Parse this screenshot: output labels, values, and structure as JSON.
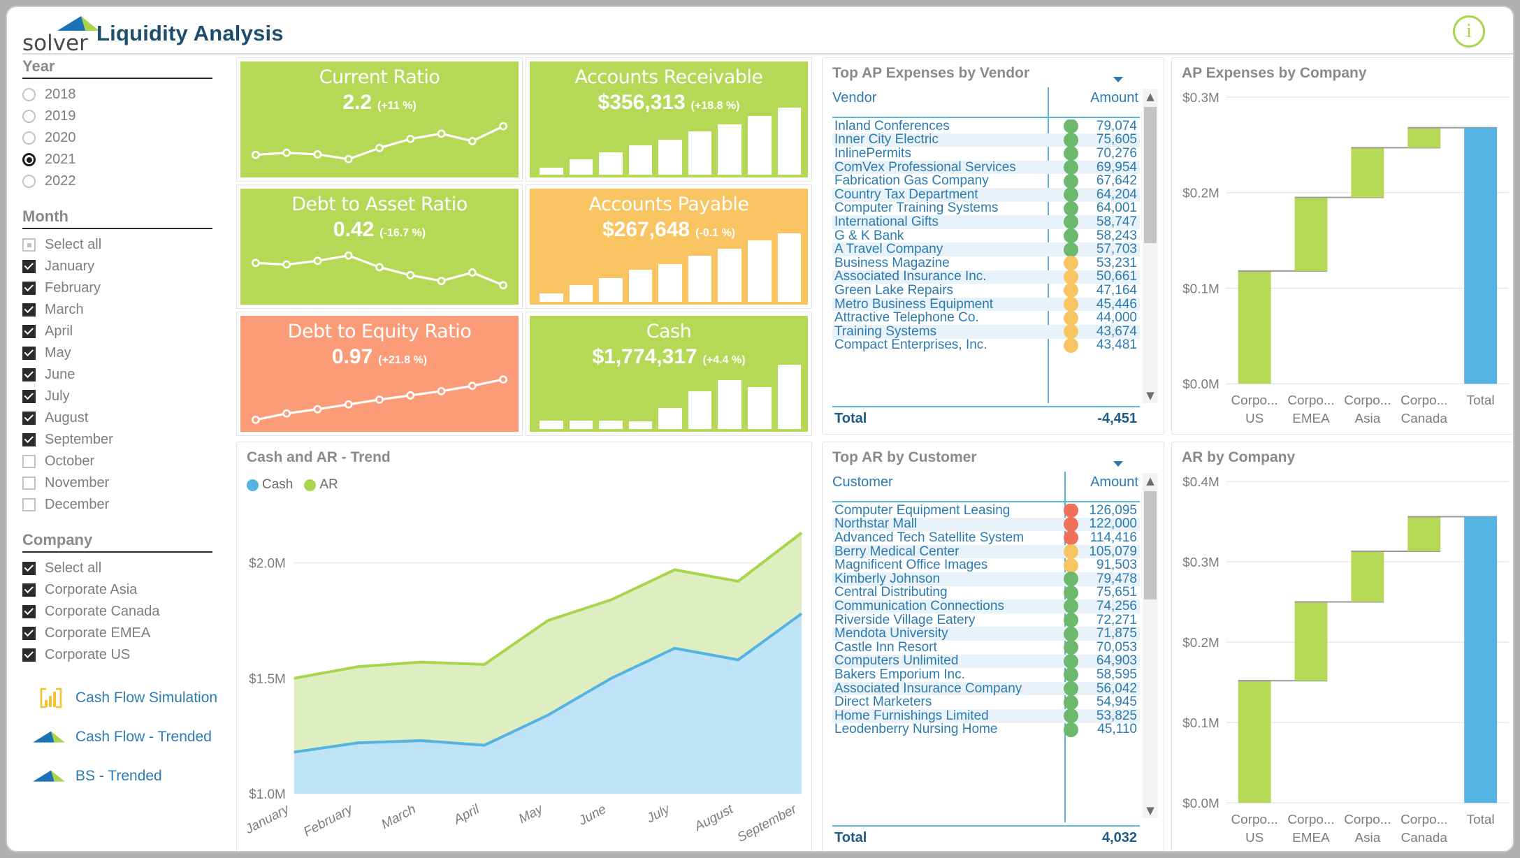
{
  "header": {
    "logo_text": "solver",
    "title": "Liquidity Analysis",
    "info_icon": "info-icon",
    "info_label": "i"
  },
  "sidebar": {
    "year": {
      "label": "Year",
      "options": [
        {
          "label": "2018",
          "selected": false
        },
        {
          "label": "2019",
          "selected": false
        },
        {
          "label": "2020",
          "selected": false
        },
        {
          "label": "2021",
          "selected": true
        },
        {
          "label": "2022",
          "selected": false
        }
      ]
    },
    "month": {
      "label": "Month",
      "options": [
        {
          "label": "Select all",
          "state": "partial"
        },
        {
          "label": "January",
          "state": "checked"
        },
        {
          "label": "February",
          "state": "checked"
        },
        {
          "label": "March",
          "state": "checked"
        },
        {
          "label": "April",
          "state": "checked"
        },
        {
          "label": "May",
          "state": "checked"
        },
        {
          "label": "June",
          "state": "checked"
        },
        {
          "label": "July",
          "state": "checked"
        },
        {
          "label": "August",
          "state": "checked"
        },
        {
          "label": "September",
          "state": "checked"
        },
        {
          "label": "October",
          "state": "unchecked"
        },
        {
          "label": "November",
          "state": "unchecked"
        },
        {
          "label": "December",
          "state": "unchecked"
        }
      ]
    },
    "company": {
      "label": "Company",
      "options": [
        {
          "label": "Select all",
          "state": "checked"
        },
        {
          "label": "Corporate Asia",
          "state": "checked"
        },
        {
          "label": "Corporate Canada",
          "state": "checked"
        },
        {
          "label": "Corporate EMEA",
          "state": "checked"
        },
        {
          "label": "Corporate US",
          "state": "checked"
        }
      ]
    },
    "links": [
      {
        "label": "Cash Flow Simulation",
        "icon": "power-bi-icon"
      },
      {
        "label": "Cash Flow - Trended",
        "icon": "solver-swoosh-icon"
      },
      {
        "label": "BS - Trended",
        "icon": "solver-swoosh-icon"
      }
    ]
  },
  "kpis": [
    {
      "name": "Current Ratio",
      "value": "2.2",
      "delta": "(+11 %)",
      "color": "#b5d957",
      "graph": "line",
      "points": [
        32,
        36,
        33,
        24,
        45,
        62,
        72,
        58,
        86
      ]
    },
    {
      "name": "Accounts Receivable",
      "value": "$356,313",
      "delta": "(+18.8 %)",
      "color": "#b5d957",
      "graph": "bar",
      "bars": [
        10,
        22,
        32,
        42,
        50,
        62,
        72,
        84,
        96
      ]
    },
    {
      "name": "Debt to Asset Ratio",
      "value": "0.42",
      "delta": "(-16.7 %)",
      "color": "#b5d957",
      "graph": "line",
      "points": [
        68,
        65,
        72,
        82,
        60,
        45,
        34,
        50,
        26
      ]
    },
    {
      "name": "Accounts Payable",
      "value": "$267,648",
      "delta": "(-0.1 %)",
      "color": "#f9c462",
      "graph": "bar",
      "bars": [
        12,
        24,
        34,
        46,
        54,
        66,
        76,
        88,
        98
      ]
    },
    {
      "name": "Debt to Equity Ratio",
      "value": "0.97",
      "delta": "(+21.8 %)",
      "color": "#fb9b78",
      "graph": "line",
      "points": [
        12,
        24,
        32,
        41,
        50,
        58,
        66,
        76,
        88
      ]
    },
    {
      "name": "Cash",
      "value": "$1,774,317",
      "delta": "(+4.4 %)",
      "color": "#b5d957",
      "graph": "bar",
      "bars": [
        12,
        12,
        12,
        11,
        30,
        54,
        70,
        60,
        92
      ]
    }
  ],
  "ap_table": {
    "title": "Top AP Expenses by Vendor",
    "col_name": "Vendor",
    "col_amount": "Amount",
    "total_label": "Total",
    "total_amount": "-4,451",
    "rows": [
      {
        "name": "Inland Conferences",
        "amount": "79,074",
        "status": "#6cb86c"
      },
      {
        "name": "Inner City Electric",
        "amount": "75,605",
        "status": "#6cb86c"
      },
      {
        "name": "InlinePermits",
        "amount": "70,276",
        "status": "#6cb86c"
      },
      {
        "name": "ComVex Professional Services",
        "amount": "69,954",
        "status": "#6cb86c"
      },
      {
        "name": "Fabrication Gas Company",
        "amount": "67,642",
        "status": "#6cb86c"
      },
      {
        "name": "Country Tax Department",
        "amount": "64,204",
        "status": "#6cb86c"
      },
      {
        "name": "Computer Training Systems",
        "amount": "64,001",
        "status": "#6cb86c"
      },
      {
        "name": "International Gifts",
        "amount": "58,747",
        "status": "#6cb86c"
      },
      {
        "name": "G & K Bank",
        "amount": "58,243",
        "status": "#6cb86c"
      },
      {
        "name": "A Travel Company",
        "amount": "57,703",
        "status": "#6cb86c"
      },
      {
        "name": "Business Magazine",
        "amount": "53,231",
        "status": "#f9c462"
      },
      {
        "name": "Associated Insurance Inc.",
        "amount": "50,661",
        "status": "#f9c462"
      },
      {
        "name": "Green Lake Repairs",
        "amount": "47,164",
        "status": "#f9c462"
      },
      {
        "name": "Metro Business Equipment",
        "amount": "45,446",
        "status": "#f9c462"
      },
      {
        "name": "Attractive Telephone Co.",
        "amount": "44,000",
        "status": "#f9c462"
      },
      {
        "name": "Training Systems",
        "amount": "43,674",
        "status": "#f9c462"
      },
      {
        "name": "Compact Enterprises, Inc.",
        "amount": "43,481",
        "status": "#f9c462"
      }
    ]
  },
  "ar_table": {
    "title": "Top AR by Customer",
    "col_name": "Customer",
    "col_amount": "Amount",
    "total_label": "Total",
    "total_amount": "4,032",
    "rows": [
      {
        "name": "Computer Equipment Leasing",
        "amount": "126,095",
        "status": "#f0705a"
      },
      {
        "name": "Northstar Mall",
        "amount": "122,000",
        "status": "#f0705a"
      },
      {
        "name": "Advanced Tech Satellite System",
        "amount": "114,416",
        "status": "#f0705a"
      },
      {
        "name": "Berry Medical Center",
        "amount": "105,079",
        "status": "#f9c462"
      },
      {
        "name": "Magnificent Office Images",
        "amount": "91,503",
        "status": "#f9c462"
      },
      {
        "name": "Kimberly Johnson",
        "amount": "79,478",
        "status": "#6cb86c"
      },
      {
        "name": "Central Distributing",
        "amount": "75,651",
        "status": "#6cb86c"
      },
      {
        "name": "Communication Connections",
        "amount": "74,256",
        "status": "#6cb86c"
      },
      {
        "name": "Riverside Village Eatery",
        "amount": "72,271",
        "status": "#6cb86c"
      },
      {
        "name": "Mendota University",
        "amount": "71,875",
        "status": "#6cb86c"
      },
      {
        "name": "Castle Inn Resort",
        "amount": "70,053",
        "status": "#6cb86c"
      },
      {
        "name": "Computers Unlimited",
        "amount": "64,903",
        "status": "#6cb86c"
      },
      {
        "name": "Bakers Emporium Inc.",
        "amount": "58,595",
        "status": "#6cb86c"
      },
      {
        "name": "Associated Insurance Company",
        "amount": "56,042",
        "status": "#6cb86c"
      },
      {
        "name": "Direct Marketers",
        "amount": "54,945",
        "status": "#6cb86c"
      },
      {
        "name": "Home Furnishings Limited",
        "amount": "53,825",
        "status": "#6cb86c"
      },
      {
        "name": "Leodenberry Nursing Home",
        "amount": "45,110",
        "status": "#6cb86c"
      }
    ]
  },
  "chart_data": [
    {
      "id": "ap_by_company",
      "type": "bar",
      "subtype": "waterfall",
      "title": "AP Expenses by Company",
      "xlabel": "",
      "ylabel": "",
      "categories": [
        "Corpo... US",
        "Corpo... EMEA",
        "Corpo... Asia",
        "Corpo... Canada",
        "Total"
      ],
      "category_lines": [
        [
          "Corpo...",
          "US"
        ],
        [
          "Corpo...",
          "EMEA"
        ],
        [
          "Corpo...",
          "Asia"
        ],
        [
          "Corpo...",
          "Canada"
        ],
        [
          "Total"
        ]
      ],
      "values": [
        0.118,
        0.077,
        0.052,
        0.021,
        0.268
      ],
      "cumulative": [
        0.118,
        0.195,
        0.247,
        0.268,
        0.268
      ],
      "ylim": [
        0.0,
        0.3
      ],
      "yticks": [
        0.0,
        0.1,
        0.2,
        0.3
      ],
      "ytick_labels": [
        "$0.0M",
        "$0.1M",
        "$0.2M",
        "$0.3M"
      ],
      "grid": true,
      "colors": {
        "increase": "#b5d957",
        "total": "#55b3e3"
      },
      "legend": "none"
    },
    {
      "id": "cash_ar_trend",
      "type": "area",
      "subtype": "stacked",
      "title": "Cash and AR - Trend",
      "xlabel": "",
      "ylabel": "",
      "categories": [
        "January",
        "February",
        "March",
        "April",
        "May",
        "June",
        "July",
        "August",
        "September"
      ],
      "series": [
        {
          "name": "Cash",
          "color": "#55b3e3",
          "values": [
            1.18,
            1.22,
            1.23,
            1.21,
            1.34,
            1.5,
            1.63,
            1.58,
            1.78
          ]
        },
        {
          "name": "AR",
          "color": "#a9d44e",
          "values": [
            0.32,
            0.33,
            0.34,
            0.35,
            0.41,
            0.34,
            0.34,
            0.34,
            0.35
          ]
        }
      ],
      "stacked_top": [
        1.5,
        1.55,
        1.57,
        1.56,
        1.75,
        1.84,
        1.97,
        1.92,
        2.13
      ],
      "ylim": [
        1.0,
        2.25
      ],
      "yticks": [
        1.0,
        1.5,
        2.0
      ],
      "ytick_labels": [
        "$1.0M",
        "$1.5M",
        "$2.0M"
      ],
      "grid": true,
      "legend": "top-left"
    },
    {
      "id": "ar_by_company",
      "type": "bar",
      "subtype": "waterfall",
      "title": "AR by Company",
      "xlabel": "",
      "ylabel": "",
      "categories": [
        "Corpo... US",
        "Corpo... EMEA",
        "Corpo... Asia",
        "Corpo... Canada",
        "Total"
      ],
      "category_lines": [
        [
          "Corpo...",
          "US"
        ],
        [
          "Corpo...",
          "EMEA"
        ],
        [
          "Corpo...",
          "Asia"
        ],
        [
          "Corpo...",
          "Canada"
        ],
        [
          "Total"
        ]
      ],
      "values": [
        0.152,
        0.098,
        0.063,
        0.043,
        0.356
      ],
      "cumulative": [
        0.152,
        0.25,
        0.313,
        0.356,
        0.356
      ],
      "ylim": [
        0.0,
        0.4
      ],
      "yticks": [
        0.0,
        0.1,
        0.2,
        0.3,
        0.4
      ],
      "ytick_labels": [
        "$0.0M",
        "$0.1M",
        "$0.2M",
        "$0.3M",
        "$0.4M"
      ],
      "grid": true,
      "colors": {
        "increase": "#b5d957",
        "total": "#55b3e3"
      },
      "legend": "none"
    }
  ]
}
